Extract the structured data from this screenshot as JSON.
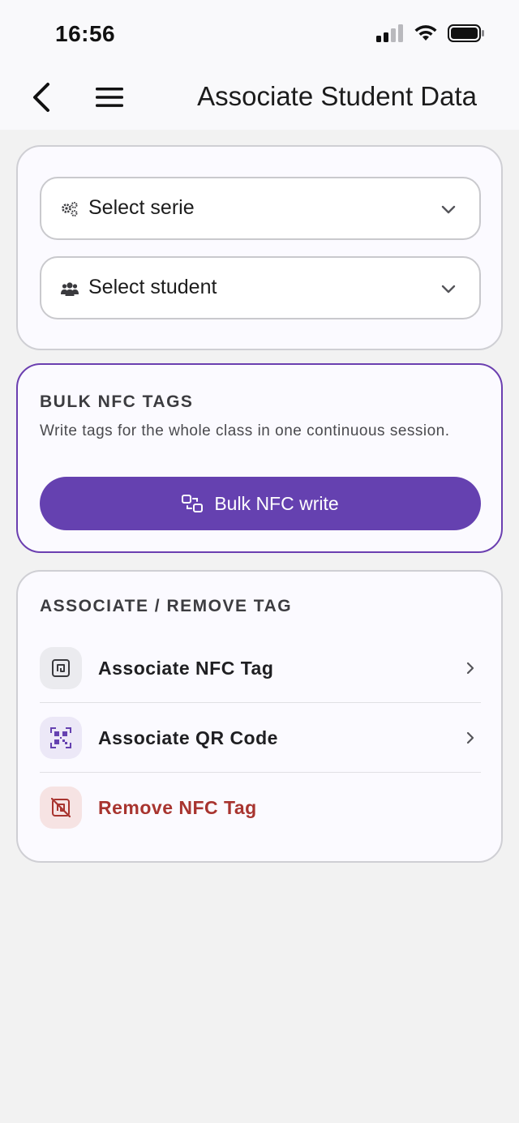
{
  "status_bar": {
    "time": "16:56",
    "icons": [
      "signal-icon",
      "wifi-icon",
      "battery-icon"
    ]
  },
  "header": {
    "title": "Associate Student Data",
    "back_icon": "chevron-left-icon",
    "menu_icon": "hamburger-menu-icon"
  },
  "selectors": {
    "serie": {
      "label": "Select serie",
      "icon": "gears-icon"
    },
    "student": {
      "label": "Select student",
      "icon": "users-icon"
    }
  },
  "bulk": {
    "title": "BULK NFC TAGS",
    "description": "Write tags for the whole class in one continuous session.",
    "button_label": "Bulk NFC write"
  },
  "associate": {
    "title": "ASSOCIATE / REMOVE TAG",
    "items": [
      {
        "label": "Associate NFC Tag",
        "icon": "nfc-tag-icon"
      },
      {
        "label": "Associate QR Code",
        "icon": "qr-code-icon"
      },
      {
        "label": "Remove NFC Tag",
        "icon": "nfc-remove-icon"
      }
    ]
  },
  "colors": {
    "accent": "#6541b0",
    "danger": "#a8342f",
    "background": "#f2f2f2"
  }
}
